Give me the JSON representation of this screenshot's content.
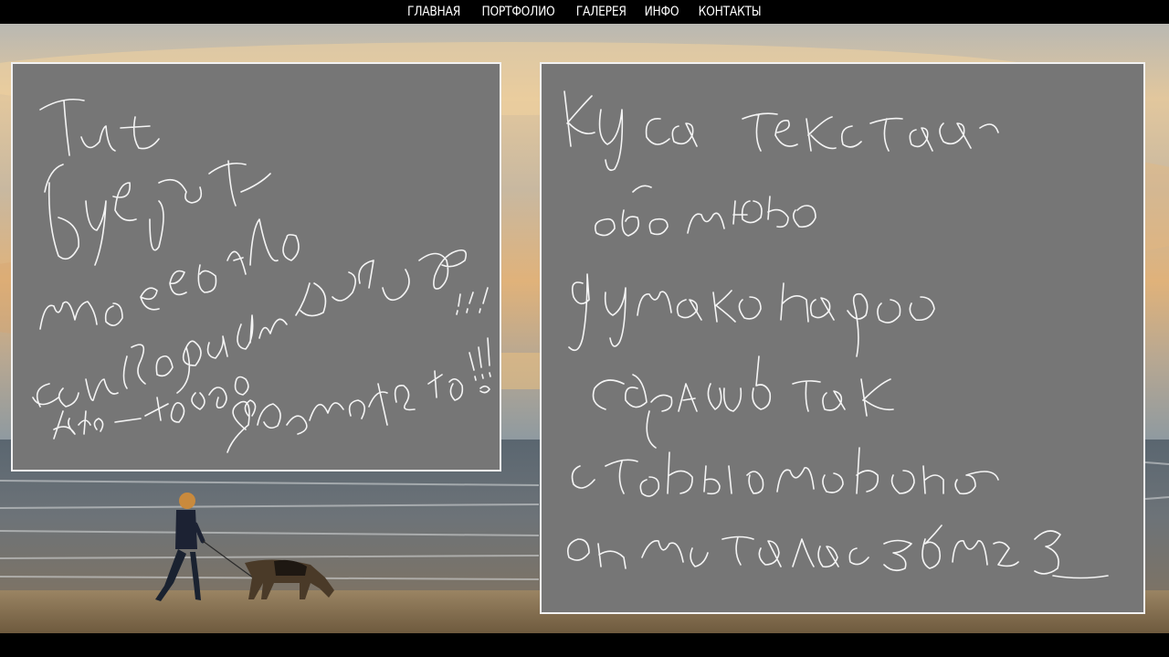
{
  "nav": {
    "items": [
      {
        "label": "ГЛАВНАЯ"
      },
      {
        "label": "ПОРТФОЛИО"
      },
      {
        "label": "ГАЛЕРЕЯ"
      },
      {
        "label": "ИНФО"
      },
      {
        "label": "КОНТАКТЫ"
      }
    ]
  },
  "background": {
    "description_icon": "beach-sunset-photo",
    "colors": {
      "sky_top": "#c9c7c0",
      "sky_glow": "#e8b87a",
      "sea": "#5c6670",
      "sand": "#8a7658"
    }
  },
  "left_note": {
    "lines": [
      "Тут",
      "Будет",
      "моё ебало",
      "если когда-нибудь",
      "кто-то его",
      "сломает!!!"
    ]
  },
  "right_note": {
    "lines": [
      "Куса текста",
      "оболю",
      "думаю надо",
      "сделать так",
      "чтобы только",
      "он листал с звнз"
    ]
  }
}
